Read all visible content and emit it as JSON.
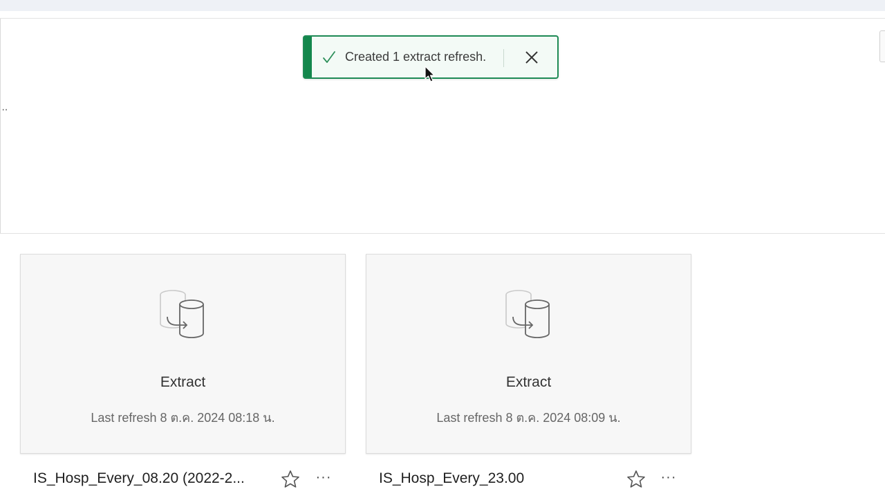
{
  "toast": {
    "message": "Created 1 extract refresh.",
    "accent_color": "#13874c",
    "icons": {
      "status": "check-icon",
      "close": "close-icon"
    }
  },
  "cards": [
    {
      "type_label": "Extract",
      "last_refresh": "Last refresh 8 ต.ค. 2024 08:18 น.",
      "title": "IS_Hosp_Every_08.20 (2022-2...",
      "icon": "extract-database-icon"
    },
    {
      "type_label": "Extract",
      "last_refresh": "Last refresh 8 ต.ค. 2024 08:09 น.",
      "title": "IS_Hosp_Every_23.00",
      "icon": "extract-database-icon"
    }
  ],
  "actions": {
    "more_glyph": "···"
  }
}
